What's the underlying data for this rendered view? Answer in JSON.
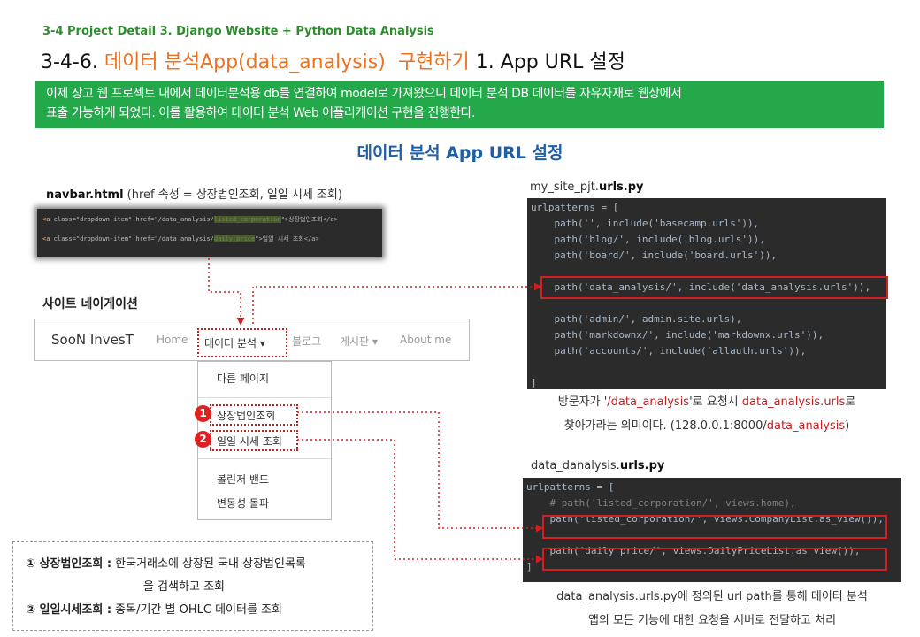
{
  "header": {
    "breadcrumb": "3-4 Project Detail 3. Django Website + Python Data Analysis",
    "title_prefix": "3-4-6.",
    "title_highlight": "데이터 분석App(data_analysis)  구현하기",
    "title_suffix": "1. App URL 설정"
  },
  "banner": {
    "line1": "이제 장고 웹 프로젝트 내에서 데이터분석용 db를 연결하여 model로 가져왔으니 데이터 분석 DB 데이터를 자유자재로 웹상에서",
    "line2": "표출 가능하게 되었다. 이를 활용하여 데이터 분석 Web 어플리케이션 구현을 진행한다."
  },
  "section_title": "데이터 분석 App URL 설정",
  "navbar_caption": {
    "file": "navbar.html",
    "note": " (href 속성 = 상장법인조회, 일일 시세 조회)"
  },
  "navbar_snippet": {
    "line1": {
      "tag": "<a",
      "attr": " class=\"dropdown-item\" href=\"/data_analysis/",
      "hl": "listed_corporation",
      "end": "\">상장법인조회</a>"
    },
    "line2": {
      "tag": "<a",
      "attr": " class=\"dropdown-item\" href=\"/data_analysis/",
      "hl": "daily_price",
      "end": "\">일일 시세 조회</a>"
    }
  },
  "site_nav_label": "사이트 네이게이션",
  "site_navbar": {
    "brand": "SooN InvesT",
    "home": "Home",
    "data_analysis": "데이터 분석",
    "blog": "블로그",
    "board": "게시판",
    "about": "About me",
    "caret": "▾"
  },
  "dropdown": {
    "other_page": "다른 페이지",
    "listed_corp": "상장법인조회",
    "daily_price": "일일 시세 조회",
    "bollinger": "볼린저 밴드",
    "volatility": "변동성 돌파",
    "badge1": "1",
    "badge2": "2"
  },
  "project_urls": {
    "caption_prefix": "my_site_pjt.",
    "caption_bold": "urls.py",
    "lines": [
      "urlpatterns = [",
      "    path('', include('basecamp.urls')),",
      "    path('blog/', include('blog.urls')),",
      "    path('board/', include('board.urls')),",
      "",
      "    path('data_analysis/', include('data_analysis.urls')),",
      "",
      "    path('admin/', admin.site.urls),",
      "    path('markdownx/', include('markdownx.urls')),",
      "    path('accounts/', include('allauth.urls')),",
      "",
      "]"
    ]
  },
  "project_expl": {
    "l1_a": "방문자가 '",
    "l1_b": "/data_analysis",
    "l1_c": "'로 요청시 ",
    "l1_d": "data_analysis.urls",
    "l1_e": "로",
    "l2_a": "찾아가라는 의미이다. (128.0.0.1:8000/",
    "l2_b": "data_analysis",
    "l2_c": ")"
  },
  "app_urls": {
    "caption_prefix": "data_danalysis.",
    "caption_bold": "urls.py",
    "lines": [
      "urlpatterns = [",
      "    # path('listed_corporation/', views.home),",
      "    path('listed_corporation/', views.CompanyList.as_view()),",
      "",
      "    path('daily_price/', views.DailyPriceList.as_view()),",
      "]"
    ]
  },
  "app_expl": {
    "line1": "data_analysis.urls.py에 정의된 url path를 통해 데이터 분석",
    "line2": "앱의 모든 기능에 대한 요청을 서버로 전달하고 처리"
  },
  "notes": {
    "n1_label": "① 상장법인조회 :",
    "n1_text": " 한국거래소에 상장된 국내 상장법인목록",
    "n1_cont": "을 검색하고 조회",
    "n2_label": "② 일일시세조회 :",
    "n2_text": " 종목/기간 별 OHLC 데이터를 조회"
  },
  "colors": {
    "accent_green": "#23a84a",
    "title_orange": "#f07020",
    "section_blue": "#1f5fa8",
    "highlight_red": "#d02020",
    "code_bg": "#2b2b2b"
  }
}
